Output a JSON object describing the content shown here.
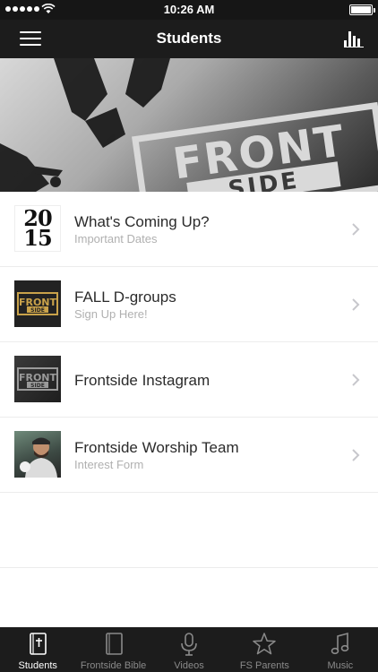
{
  "status_bar": {
    "time": "10:26 AM"
  },
  "nav": {
    "title": "Students"
  },
  "hero": {
    "logo_line1": "FRONT",
    "logo_line2": "SIDE"
  },
  "list": {
    "items": [
      {
        "title": "What's Coming Up?",
        "subtitle": "Important Dates",
        "thumb_line1": "20",
        "thumb_line2": "15"
      },
      {
        "title": "FALL D-groups",
        "subtitle": "Sign Up Here!",
        "thumb_line1": "FRONT",
        "thumb_line2": "SIDE"
      },
      {
        "title": "Frontside Instagram",
        "subtitle": "",
        "thumb_line1": "FRONT",
        "thumb_line2": "SIDE"
      },
      {
        "title": "Frontside Worship Team",
        "subtitle": "Interest Form"
      }
    ]
  },
  "tabs": [
    {
      "label": "Students",
      "icon": "bible-cross-icon",
      "active": true
    },
    {
      "label": "Frontside Bible",
      "icon": "book-icon",
      "active": false
    },
    {
      "label": "Videos",
      "icon": "microphone-icon",
      "active": false
    },
    {
      "label": "FS Parents",
      "icon": "star-icon",
      "active": false
    },
    {
      "label": "Music",
      "icon": "music-note-icon",
      "active": false
    }
  ],
  "colors": {
    "bar_background": "#1c1c1c",
    "active_tab": "#ffffff",
    "inactive_tab": "#8a8a8a",
    "subtitle_gray": "#b0b0b0",
    "gold_logo": "#c9a24a"
  }
}
